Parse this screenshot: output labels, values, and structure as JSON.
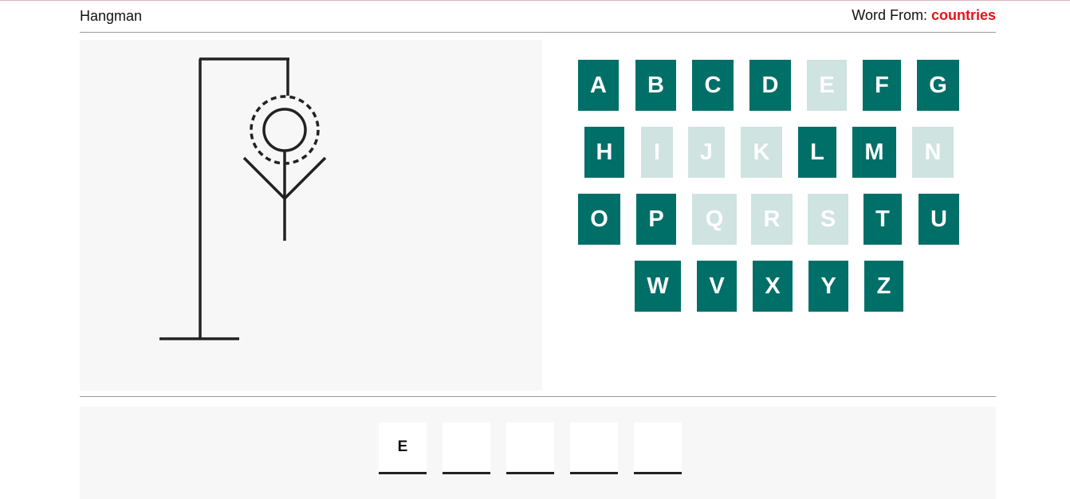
{
  "header": {
    "title": "Hangman",
    "word_from_label": "Word From: ",
    "category": "countries"
  },
  "colors": {
    "key_active": "#006f68",
    "key_used": "#cfe3e1",
    "category_text": "#e2151b",
    "panel_bg": "#f7f7f7"
  },
  "keyboard": {
    "rows": [
      [
        {
          "letter": "A",
          "used": false
        },
        {
          "letter": "B",
          "used": false
        },
        {
          "letter": "C",
          "used": false
        },
        {
          "letter": "D",
          "used": false
        },
        {
          "letter": "E",
          "used": true
        },
        {
          "letter": "F",
          "used": false
        },
        {
          "letter": "G",
          "used": false
        }
      ],
      [
        {
          "letter": "H",
          "used": false
        },
        {
          "letter": "I",
          "used": true
        },
        {
          "letter": "J",
          "used": true
        },
        {
          "letter": "K",
          "used": true
        },
        {
          "letter": "L",
          "used": false
        },
        {
          "letter": "M",
          "used": false
        },
        {
          "letter": "N",
          "used": true
        }
      ],
      [
        {
          "letter": "O",
          "used": false
        },
        {
          "letter": "P",
          "used": false
        },
        {
          "letter": "Q",
          "used": true
        },
        {
          "letter": "R",
          "used": true
        },
        {
          "letter": "S",
          "used": true
        },
        {
          "letter": "T",
          "used": false
        },
        {
          "letter": "U",
          "used": false
        }
      ],
      [
        {
          "letter": "W",
          "used": false
        },
        {
          "letter": "V",
          "used": false
        },
        {
          "letter": "X",
          "used": false
        },
        {
          "letter": "Y",
          "used": false
        },
        {
          "letter": "Z",
          "used": false
        }
      ]
    ]
  },
  "word": {
    "slots": [
      "E",
      "",
      "",
      "",
      ""
    ]
  }
}
